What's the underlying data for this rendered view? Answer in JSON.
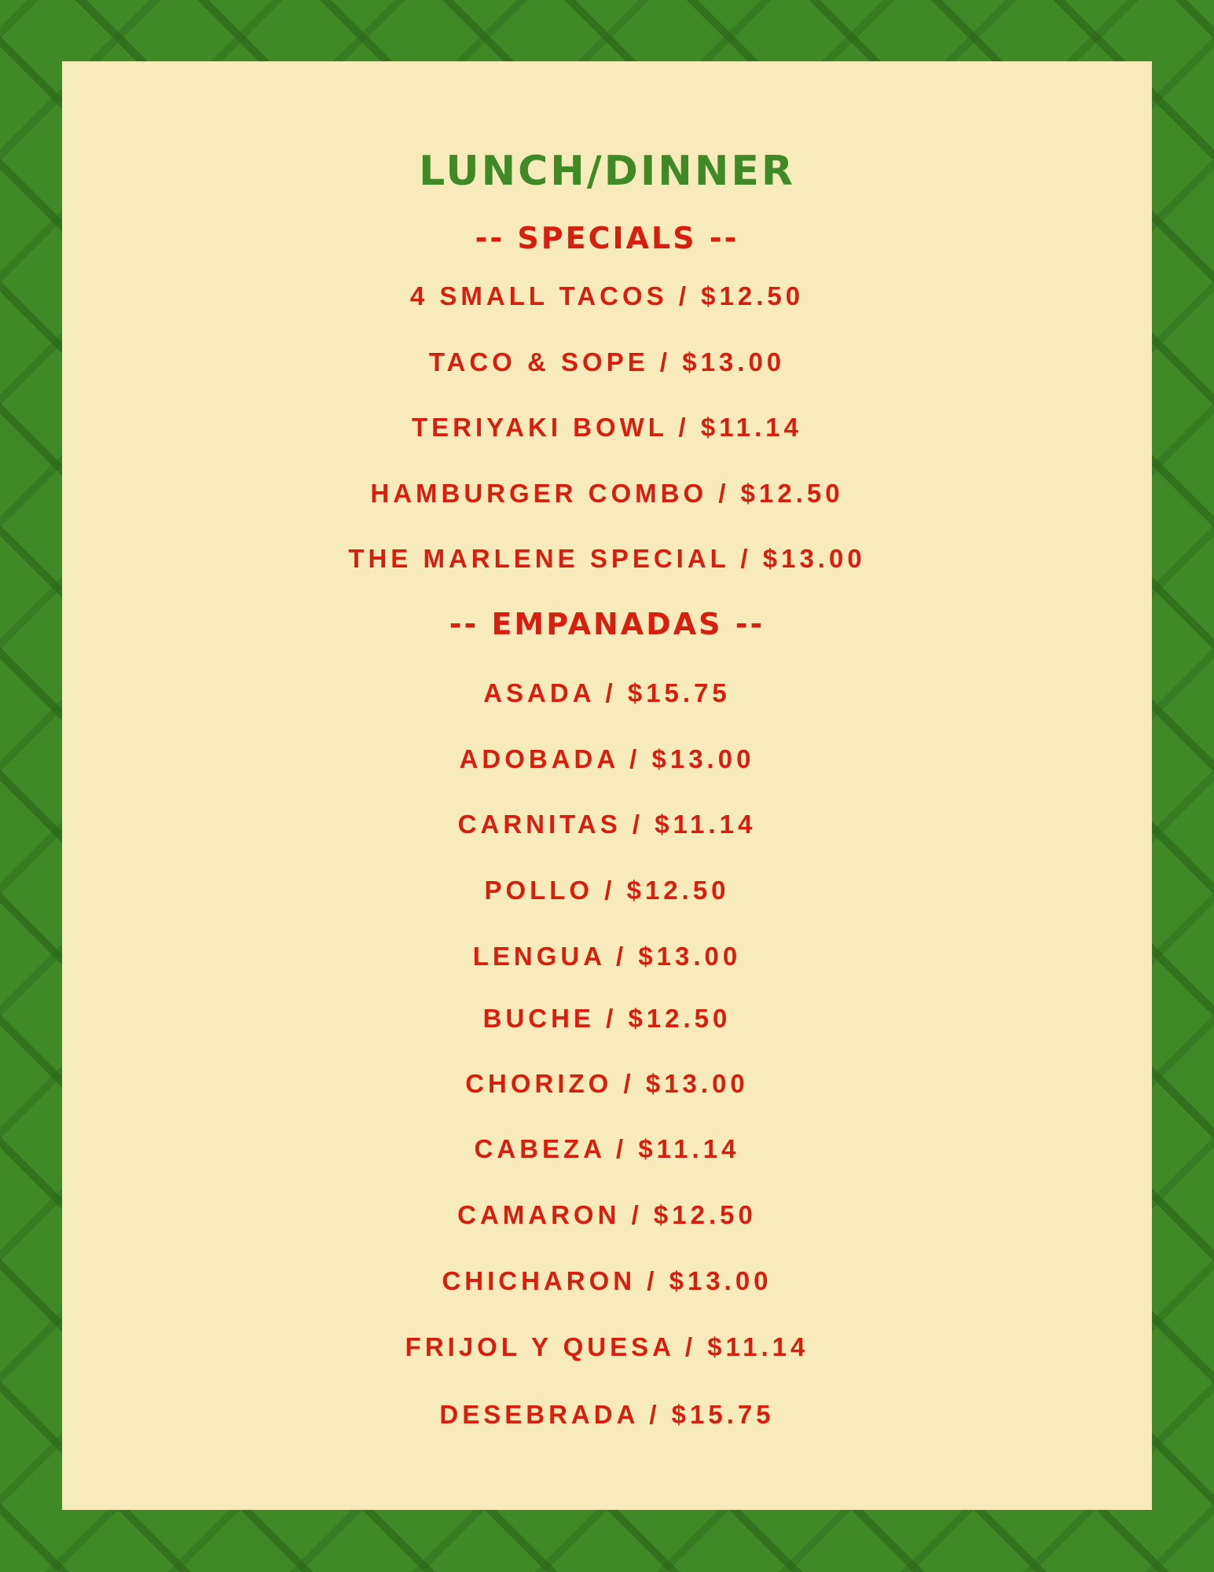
{
  "menu": {
    "title": "LUNCH/DINNER",
    "specials_heading": "--  SPECIALS  --",
    "specials": [
      "4 SMALL TACOS / $12.50",
      "TACO & SOPE / $13.00",
      "TERIYAKI BOWL / $11.14",
      "HAMBURGER COMBO / $12.50",
      "THE MARLENE SPECIAL / $13.00"
    ],
    "empanadas_heading": "--  EMPANADAS  --",
    "empanadas": [
      "ASADA / $15.75",
      "ADOBADA / $13.00",
      "CARNITAS / $11.14",
      "POLLO / $12.50",
      "LENGUA / $13.00",
      "BUCHE / $12.50",
      "CHORIZO / $13.00",
      "CABEZA / $11.14",
      "CAMARON / $12.50",
      "CHICHARON / $13.00",
      "FRIJOL Y QUESA / $11.14",
      "DESEBRADA / $15.75"
    ]
  },
  "colors": {
    "background_green": "#3f8a26",
    "paper": "#f8ebbb",
    "title_green": "#3f8a26",
    "text_red": "#d71f0f"
  }
}
